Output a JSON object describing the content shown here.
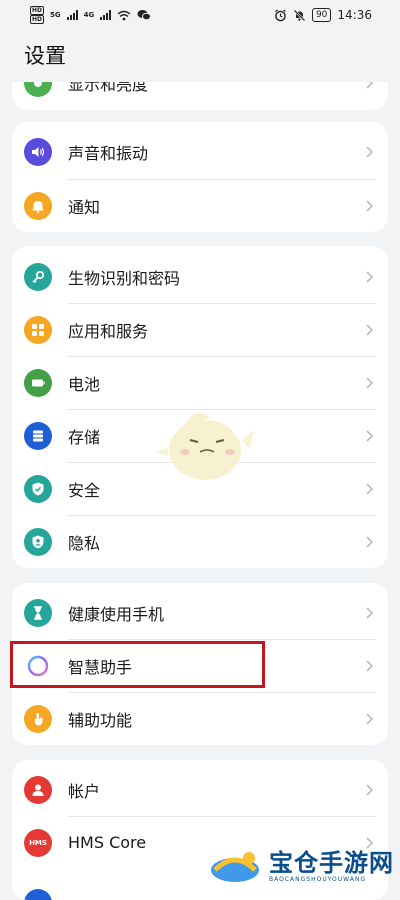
{
  "status_bar": {
    "sim1": "HD",
    "sim2": "HD",
    "sig1": "5G",
    "sig2": "4G",
    "battery": "90",
    "time": "14:36"
  },
  "page_title": "设置",
  "card0": {
    "partial_item": "显示和亮度"
  },
  "card1": {
    "items": [
      "声音和振动",
      "通知"
    ]
  },
  "card2": {
    "items": [
      "生物识别和密码",
      "应用和服务",
      "电池",
      "存储",
      "安全",
      "隐私"
    ]
  },
  "card3": {
    "items": [
      "健康使用手机",
      "智慧助手",
      "辅助功能"
    ]
  },
  "card4": {
    "items": [
      "帐户",
      "HMS Core"
    ],
    "hms_icon_text": "HMS"
  },
  "colors": {
    "display": "#4caf50",
    "sound": "#5b4bdb",
    "notify": "#f5a623",
    "biometric": "#26a69a",
    "apps": "#f5a623",
    "battery": "#43a047",
    "storage": "#1e5fd6",
    "security": "#26a69a",
    "privacy": "#26a69a",
    "health": "#26a69a",
    "assistant_ring": "#8a6bff",
    "accessibility": "#f5a623",
    "account": "#e53935",
    "hms": "#e53935",
    "highlight": "#c4161c"
  },
  "watermark": {
    "cn": "宝仓手游网",
    "en": "BAOCANGSHOUYOUWANG"
  }
}
